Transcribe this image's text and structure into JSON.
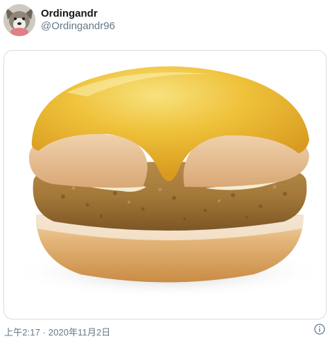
{
  "author": {
    "display_name": "Ordingandr",
    "handle": "@Ordingandr96",
    "avatar_icon": "wolf-avatar"
  },
  "media": {
    "subject": "cheese-topped burger",
    "colors": {
      "cheese": "#f2c63a",
      "bun": "#e7c093",
      "patty": "#9a7233",
      "bottom_bun": "#d7a463"
    }
  },
  "footer": {
    "timestamp": "上午2:17 · 2020年11月2日",
    "info_icon": "info-icon"
  }
}
